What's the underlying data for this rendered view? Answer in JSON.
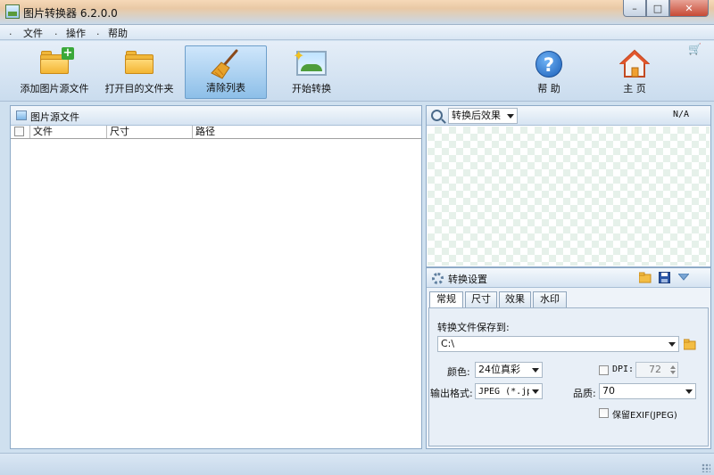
{
  "window": {
    "title": "图片转换器 6.2.0.0",
    "controls": {
      "minimize": "–",
      "maximize": "□",
      "close": "✕"
    }
  },
  "menu": {
    "items": [
      {
        "label": "文件"
      },
      {
        "label": "操作"
      },
      {
        "label": "帮助"
      }
    ]
  },
  "toolbar": {
    "add_source": "添加图片源文件",
    "open_target": "打开目的文件夹",
    "clear_list": "清除列表",
    "start_convert": "开始转换",
    "help": "帮 助",
    "home": "主 页"
  },
  "source_panel": {
    "title": "图片源文件",
    "columns": [
      "文件",
      "尺寸",
      "路径"
    ],
    "rows": []
  },
  "preview_panel": {
    "mode": "转换后效果",
    "info": "N/A"
  },
  "settings": {
    "title": "转换设置",
    "tabs": [
      "常规",
      "尺寸",
      "效果",
      "水印"
    ],
    "active_tab": "常规",
    "save_to_label": "转换文件保存到:",
    "save_path": "C:\\",
    "color_label": "颜色:",
    "color_value": "24位真彩",
    "format_label": "输出格式:",
    "format_value": "JPEG (*.jpg",
    "dpi_label": "DPI:",
    "dpi_value": "72",
    "quality_label": "品质:",
    "quality_value": "70",
    "keep_exif_label": "保留EXIF(JPEG)"
  },
  "colors": {
    "accent": "#8dbfe8",
    "panel_border": "#8eaac7",
    "folder": "#f0b73a"
  }
}
